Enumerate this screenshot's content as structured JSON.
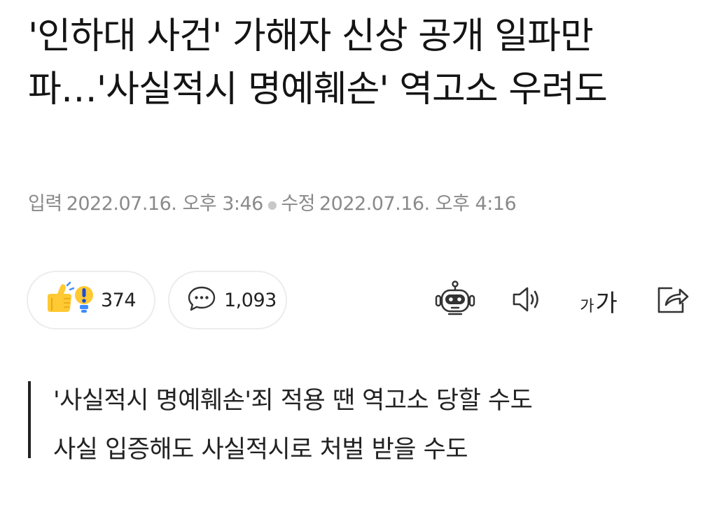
{
  "article": {
    "headline": "'인하대 사건' 가해자 신상 공개 일파만파…'사실적시 명예훼손' 역고소 우려도",
    "meta": {
      "posted_label": "입력",
      "posted_time": "2022.07.16. 오후 3:46",
      "updated_label": "수정",
      "updated_time": "2022.07.16. 오후 4:16"
    },
    "summary": [
      "'사실적시 명예훼손'죄 적용 땐 역고소 당할 수도",
      "사실 입증해도 사실적시로 처벌 받을 수도"
    ]
  },
  "reactions": {
    "reaction_count": "374",
    "comment_count": "1,093"
  },
  "toolbar": {
    "font_small": "가",
    "font_large": "가"
  },
  "icons": {
    "reaction": "thumbs-up-exclaim-icon",
    "comment": "speech-bubble-icon",
    "robot": "robot-summary-icon",
    "speaker": "speaker-icon",
    "font": "font-size-icon",
    "share": "share-icon"
  },
  "colors": {
    "meta_text": "#8a8a8a",
    "pill_border": "#ececec",
    "emoji_yellow": "#ffc933",
    "emoji_blue": "#3d8bff"
  }
}
